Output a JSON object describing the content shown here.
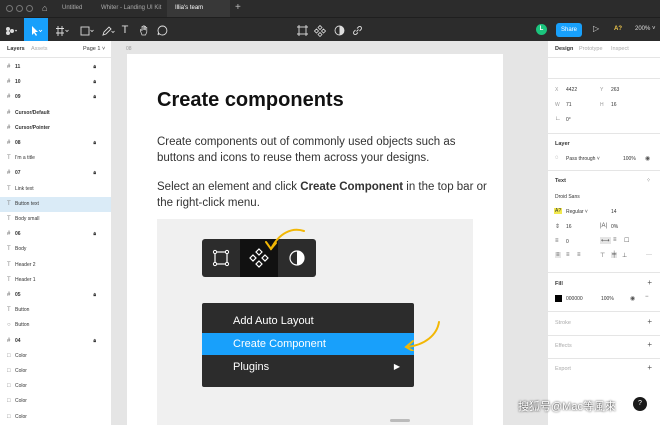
{
  "titlebar": {
    "tabs": [
      "Untitled",
      "Whiter - Landing UI Kit",
      "Illia's team library"
    ],
    "close_glyph": "×",
    "plus_glyph": "+"
  },
  "toolbar": {
    "text_tool": "T",
    "avatar_initial": "L",
    "share_label": "Share",
    "zoom": "200%"
  },
  "left_panel": {
    "tabs": [
      "Layers",
      "Assets"
    ],
    "page": "Page 1 ˅",
    "layers": [
      {
        "label": "11",
        "icon": "frame",
        "locked": true
      },
      {
        "label": "10",
        "icon": "frame",
        "locked": true
      },
      {
        "label": "09",
        "icon": "frame",
        "locked": true
      },
      {
        "label": "Cursor/Default",
        "icon": "frame",
        "locked": false
      },
      {
        "label": "Cursor/Pointer",
        "icon": "frame",
        "locked": false
      },
      {
        "label": "08",
        "icon": "frame",
        "locked": true
      },
      {
        "label": "I'm a title",
        "icon": "text",
        "locked": false
      },
      {
        "label": "07",
        "icon": "frame",
        "locked": true
      },
      {
        "label": "Link text",
        "icon": "text",
        "locked": false
      },
      {
        "label": "Button text",
        "icon": "text",
        "locked": false,
        "selected": true
      },
      {
        "label": "Body small",
        "icon": "text",
        "locked": false
      },
      {
        "label": "06",
        "icon": "frame",
        "locked": true
      },
      {
        "label": "Body",
        "icon": "text",
        "locked": false
      },
      {
        "label": "Header 2",
        "icon": "text",
        "locked": false
      },
      {
        "label": "Header 1",
        "icon": "text",
        "locked": false
      },
      {
        "label": "05",
        "icon": "frame",
        "locked": true
      },
      {
        "label": "Button",
        "icon": "text",
        "locked": false
      },
      {
        "label": "Button",
        "icon": "ellipse",
        "locked": false
      },
      {
        "label": "04",
        "icon": "frame",
        "locked": true
      },
      {
        "label": "Color",
        "icon": "rect",
        "locked": false
      },
      {
        "label": "Color",
        "icon": "rect",
        "locked": false
      },
      {
        "label": "Color",
        "icon": "rect",
        "locked": false
      },
      {
        "label": "Color",
        "icon": "rect",
        "locked": false
      },
      {
        "label": "Color",
        "icon": "rect",
        "locked": false
      }
    ]
  },
  "canvas": {
    "frame_label": "08",
    "heading": "Create components",
    "para1": "Create components out of commonly used objects such as buttons and icons to reuse them across your designs.",
    "para2_pre": "Select an element and click ",
    "para2_bold": "Create Component",
    "para2_post": " in the top bar or the right-click menu.",
    "menu": [
      "Add Auto Layout",
      "Create Component",
      "Plugins"
    ]
  },
  "right_panel": {
    "tabs": [
      "Design",
      "Prototype",
      "Inspect"
    ],
    "x_label": "X",
    "x": "4422",
    "y_label": "Y",
    "y": "263",
    "w_label": "W",
    "w": "71",
    "h_label": "H",
    "h": "16",
    "rotation": "0°",
    "layer_title": "Layer",
    "blend": "Pass through ˅",
    "opacity": "100%",
    "text_title": "Text",
    "font": "Droid Sans",
    "weight": "Regular ˅",
    "size": "14",
    "line_height": "16",
    "letter_spacing": "0%",
    "para_spacing": "0",
    "fill_title": "Fill",
    "fill_hex": "000000",
    "fill_opacity": "100%",
    "stroke_title": "Stroke",
    "effects_title": "Effects",
    "export_title": "Export"
  },
  "watermark": "搜狐号@Mac等風來",
  "help": "?",
  "colors": {
    "accent": "#18a0fb",
    "chrome": "#2c2c2c",
    "selection": "#daebf7"
  }
}
